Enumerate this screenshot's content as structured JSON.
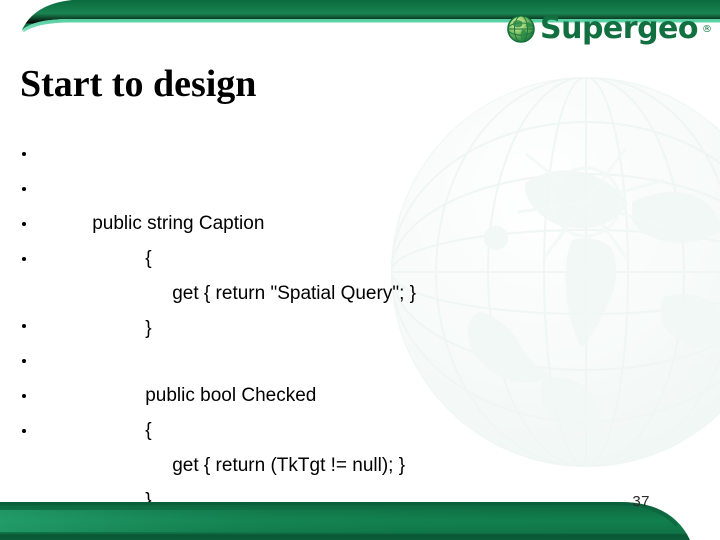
{
  "slide": {
    "title": "Start to design",
    "page_number": "37",
    "colors": {
      "band_dark": "#0d6b40",
      "band_mid": "#1b8250",
      "band_light": "#39c08a",
      "footer_green": "#0f7346",
      "footer_dark": "#0b5c38",
      "logo_green": "#127040",
      "text_black": "#000000",
      "watermark_teal": "#cfe4dd"
    }
  },
  "logo": {
    "name": "Supergeo",
    "registered_mark": "®",
    "globe_icon": "globe-icon"
  },
  "content": {
    "blocks": [
      {
        "lines": [
          {
            "text": "public string Caption",
            "indent": 0,
            "bullet": "•"
          },
          {
            "text": "{",
            "indent": 1,
            "bullet": "•"
          },
          {
            "text": "get { return \"Spatial Query\"; }",
            "indent": 2,
            "bullet": "•"
          },
          {
            "text": "}",
            "indent": 1,
            "bullet": "•"
          }
        ]
      },
      {
        "lines": [
          {
            "text": "public bool Checked",
            "indent": 1,
            "bullet": "•"
          },
          {
            "text": "{",
            "indent": 1,
            "bullet": "•"
          },
          {
            "text": "get { return (TkTgt != null); }",
            "indent": 2,
            "bullet": "•"
          },
          {
            "text": "}",
            "indent": 1,
            "bullet": "•"
          }
        ]
      }
    ]
  }
}
